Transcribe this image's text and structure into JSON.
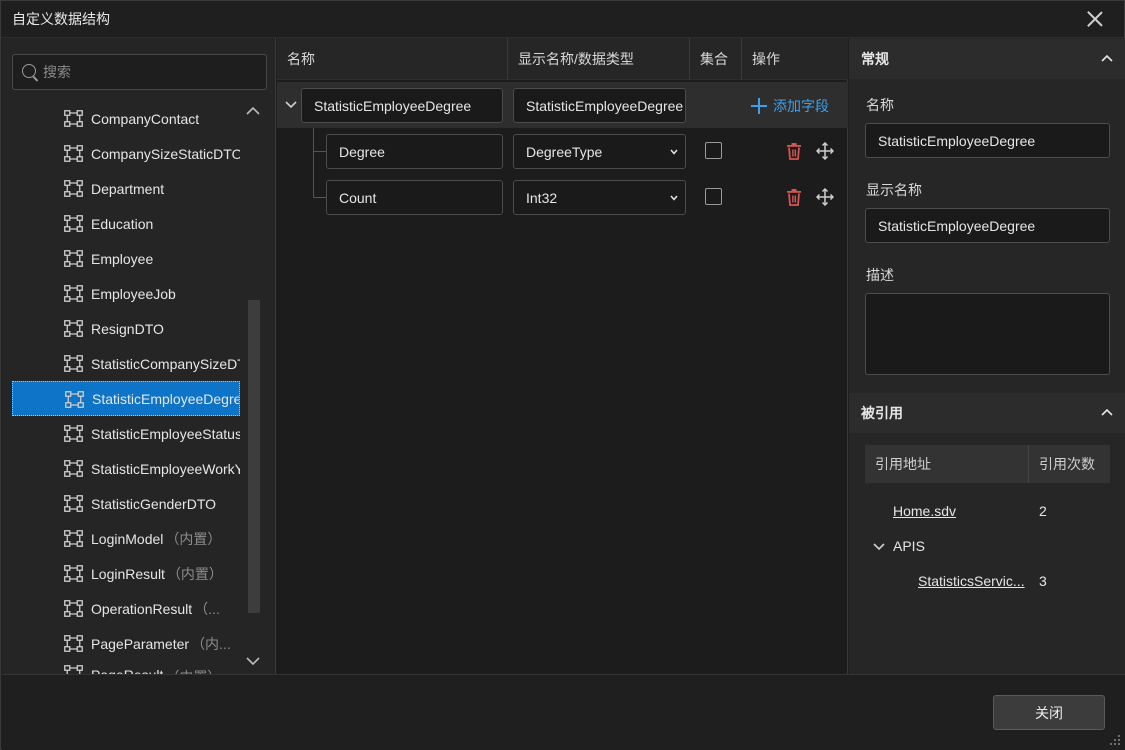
{
  "window": {
    "title": "自定义数据结构"
  },
  "sidebar": {
    "search_placeholder": "搜索",
    "items": [
      {
        "label": "CompanyContact",
        "suffix": ""
      },
      {
        "label": "CompanySizeStaticDTO",
        "suffix": ""
      },
      {
        "label": "Department",
        "suffix": ""
      },
      {
        "label": "Education",
        "suffix": ""
      },
      {
        "label": "Employee",
        "suffix": ""
      },
      {
        "label": "EmployeeJob",
        "suffix": ""
      },
      {
        "label": "ResignDTO",
        "suffix": ""
      },
      {
        "label": "StatisticCompanySizeDTO",
        "suffix": ""
      },
      {
        "label": "StatisticEmployeeDegree",
        "suffix": ""
      },
      {
        "label": "StatisticEmployeeStatusDTO",
        "suffix": ""
      },
      {
        "label": "StatisticEmployeeWorkYearDTO",
        "suffix": ""
      },
      {
        "label": "StatisticGenderDTO",
        "suffix": ""
      },
      {
        "label": "LoginModel",
        "suffix": "（内置）"
      },
      {
        "label": "LoginResult",
        "suffix": "（内置）"
      },
      {
        "label": "OperationResult",
        "suffix": "（..."
      },
      {
        "label": "PageParameter",
        "suffix": "（内..."
      },
      {
        "label": "PageResult",
        "suffix": "（内置）"
      }
    ],
    "selected_index": 8
  },
  "grid": {
    "columns": {
      "name": "名称",
      "display_type": "显示名称/数据类型",
      "collection": "集合",
      "actions": "操作"
    },
    "parent": {
      "name": "StatisticEmployeeDegree",
      "display_name": "StatisticEmployeeDegree",
      "add_label": "添加字段"
    },
    "fields": [
      {
        "name": "Degree",
        "type": "DegreeType",
        "collection": false
      },
      {
        "name": "Count",
        "type": "Int32",
        "collection": false
      }
    ]
  },
  "properties": {
    "general_title": "常规",
    "name_label": "名称",
    "name_value": "StatisticEmployeeDegree",
    "display_label": "显示名称",
    "display_value": "StatisticEmployeeDegree",
    "desc_label": "描述",
    "desc_value": "",
    "refs_title": "被引用",
    "ref_col_address": "引用地址",
    "ref_col_count": "引用次数",
    "refs": [
      {
        "address": "Home.sdv",
        "count": "2"
      },
      {
        "folder": "APIS"
      },
      {
        "address": "StatisticsServic...",
        "count": "3"
      }
    ]
  },
  "footer": {
    "close_label": "关闭"
  },
  "colors": {
    "accent": "#0e74c8",
    "link": "#3ea0ea",
    "danger": "#d9534f"
  }
}
